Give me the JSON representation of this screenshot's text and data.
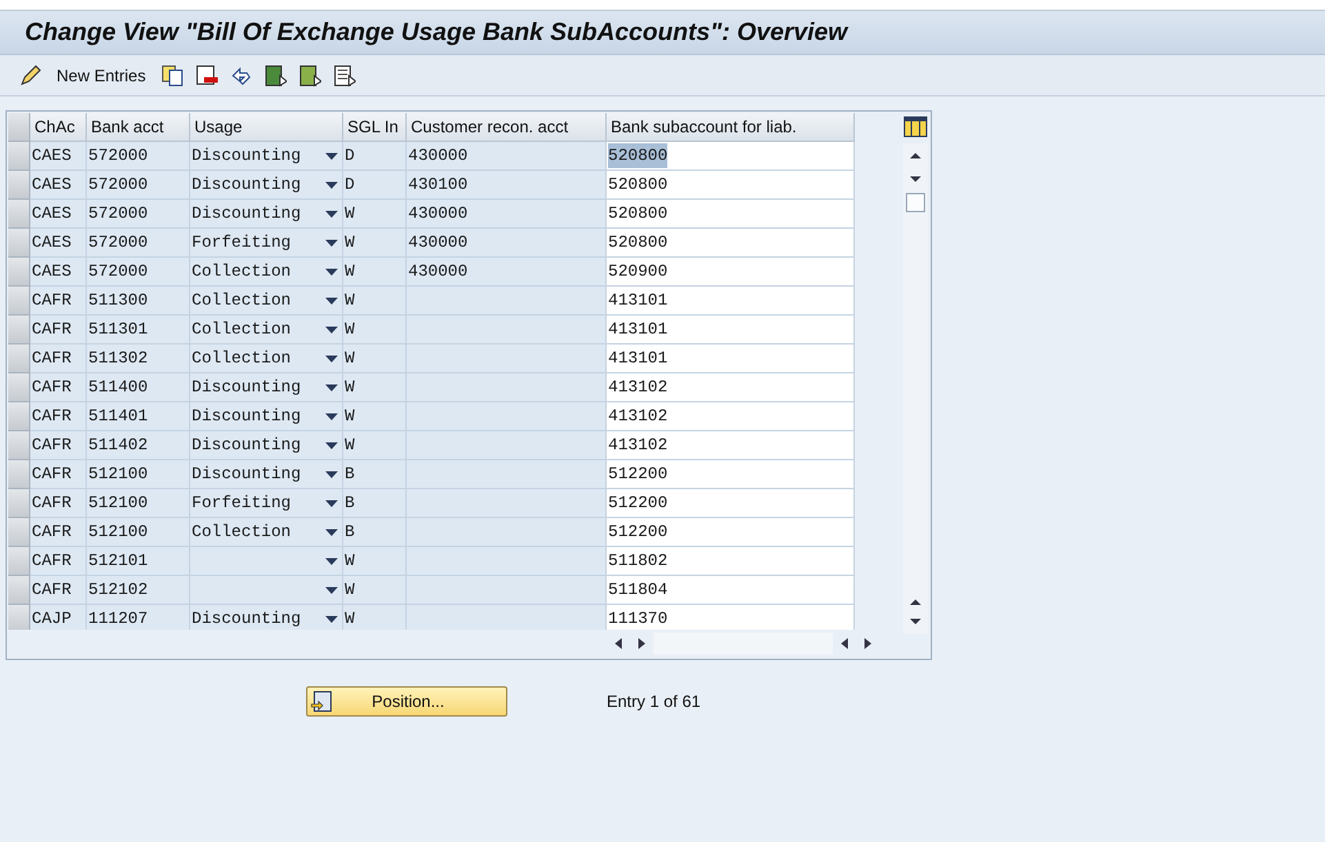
{
  "window": {
    "title": "Change View \"Bill Of Exchange Usage Bank SubAccounts\": Overview"
  },
  "toolbar": {
    "new_entries": "New Entries"
  },
  "table": {
    "columns": [
      "ChAc",
      "Bank acct",
      "Usage",
      "SGL In",
      "Customer recon. acct",
      "Bank subaccount for liab."
    ],
    "rows": [
      {
        "chac": "CAES",
        "bank_acct": "572000",
        "usage": "Discounting",
        "sgl": "D",
        "recon": "430000",
        "subaccount": "520800",
        "focused": true
      },
      {
        "chac": "CAES",
        "bank_acct": "572000",
        "usage": "Discounting",
        "sgl": "D",
        "recon": "430100",
        "subaccount": "520800",
        "focused": false
      },
      {
        "chac": "CAES",
        "bank_acct": "572000",
        "usage": "Discounting",
        "sgl": "W",
        "recon": "430000",
        "subaccount": "520800",
        "focused": false
      },
      {
        "chac": "CAES",
        "bank_acct": "572000",
        "usage": "Forfeiting",
        "sgl": "W",
        "recon": "430000",
        "subaccount": "520800",
        "focused": false
      },
      {
        "chac": "CAES",
        "bank_acct": "572000",
        "usage": "Collection",
        "sgl": "W",
        "recon": "430000",
        "subaccount": "520900",
        "focused": false
      },
      {
        "chac": "CAFR",
        "bank_acct": "511300",
        "usage": "Collection",
        "sgl": "W",
        "subaccount": "413101",
        "focused": false
      },
      {
        "chac": "CAFR",
        "bank_acct": "511301",
        "usage": "Collection",
        "sgl": "W",
        "subaccount": "413101",
        "focused": false
      },
      {
        "chac": "CAFR",
        "bank_acct": "511302",
        "usage": "Collection",
        "sgl": "W",
        "subaccount": "413101",
        "focused": false
      },
      {
        "chac": "CAFR",
        "bank_acct": "511400",
        "usage": "Discounting",
        "sgl": "W",
        "subaccount": "413102",
        "focused": false
      },
      {
        "chac": "CAFR",
        "bank_acct": "511401",
        "usage": "Discounting",
        "sgl": "W",
        "subaccount": "413102",
        "focused": false
      },
      {
        "chac": "CAFR",
        "bank_acct": "511402",
        "usage": "Discounting",
        "sgl": "W",
        "subaccount": "413102",
        "focused": false
      },
      {
        "chac": "CAFR",
        "bank_acct": "512100",
        "usage": "Discounting",
        "sgl": "B",
        "subaccount": "512200",
        "focused": false
      },
      {
        "chac": "CAFR",
        "bank_acct": "512100",
        "usage": "Forfeiting",
        "sgl": "B",
        "subaccount": "512200",
        "focused": false
      },
      {
        "chac": "CAFR",
        "bank_acct": "512100",
        "usage": "Collection",
        "sgl": "B",
        "subaccount": "512200",
        "focused": false
      },
      {
        "chac": "CAFR",
        "bank_acct": "512101",
        "sgl": "W",
        "subaccount": "511802",
        "focused": false
      },
      {
        "chac": "CAFR",
        "bank_acct": "512102",
        "sgl": "W",
        "subaccount": "511804",
        "focused": false
      },
      {
        "chac": "CAJP",
        "bank_acct": "111207",
        "usage": "Discounting",
        "sgl": "W",
        "subaccount": "111370",
        "focused": false
      }
    ]
  },
  "position_button": "Position...",
  "entry_info": "Entry 1 of 61"
}
